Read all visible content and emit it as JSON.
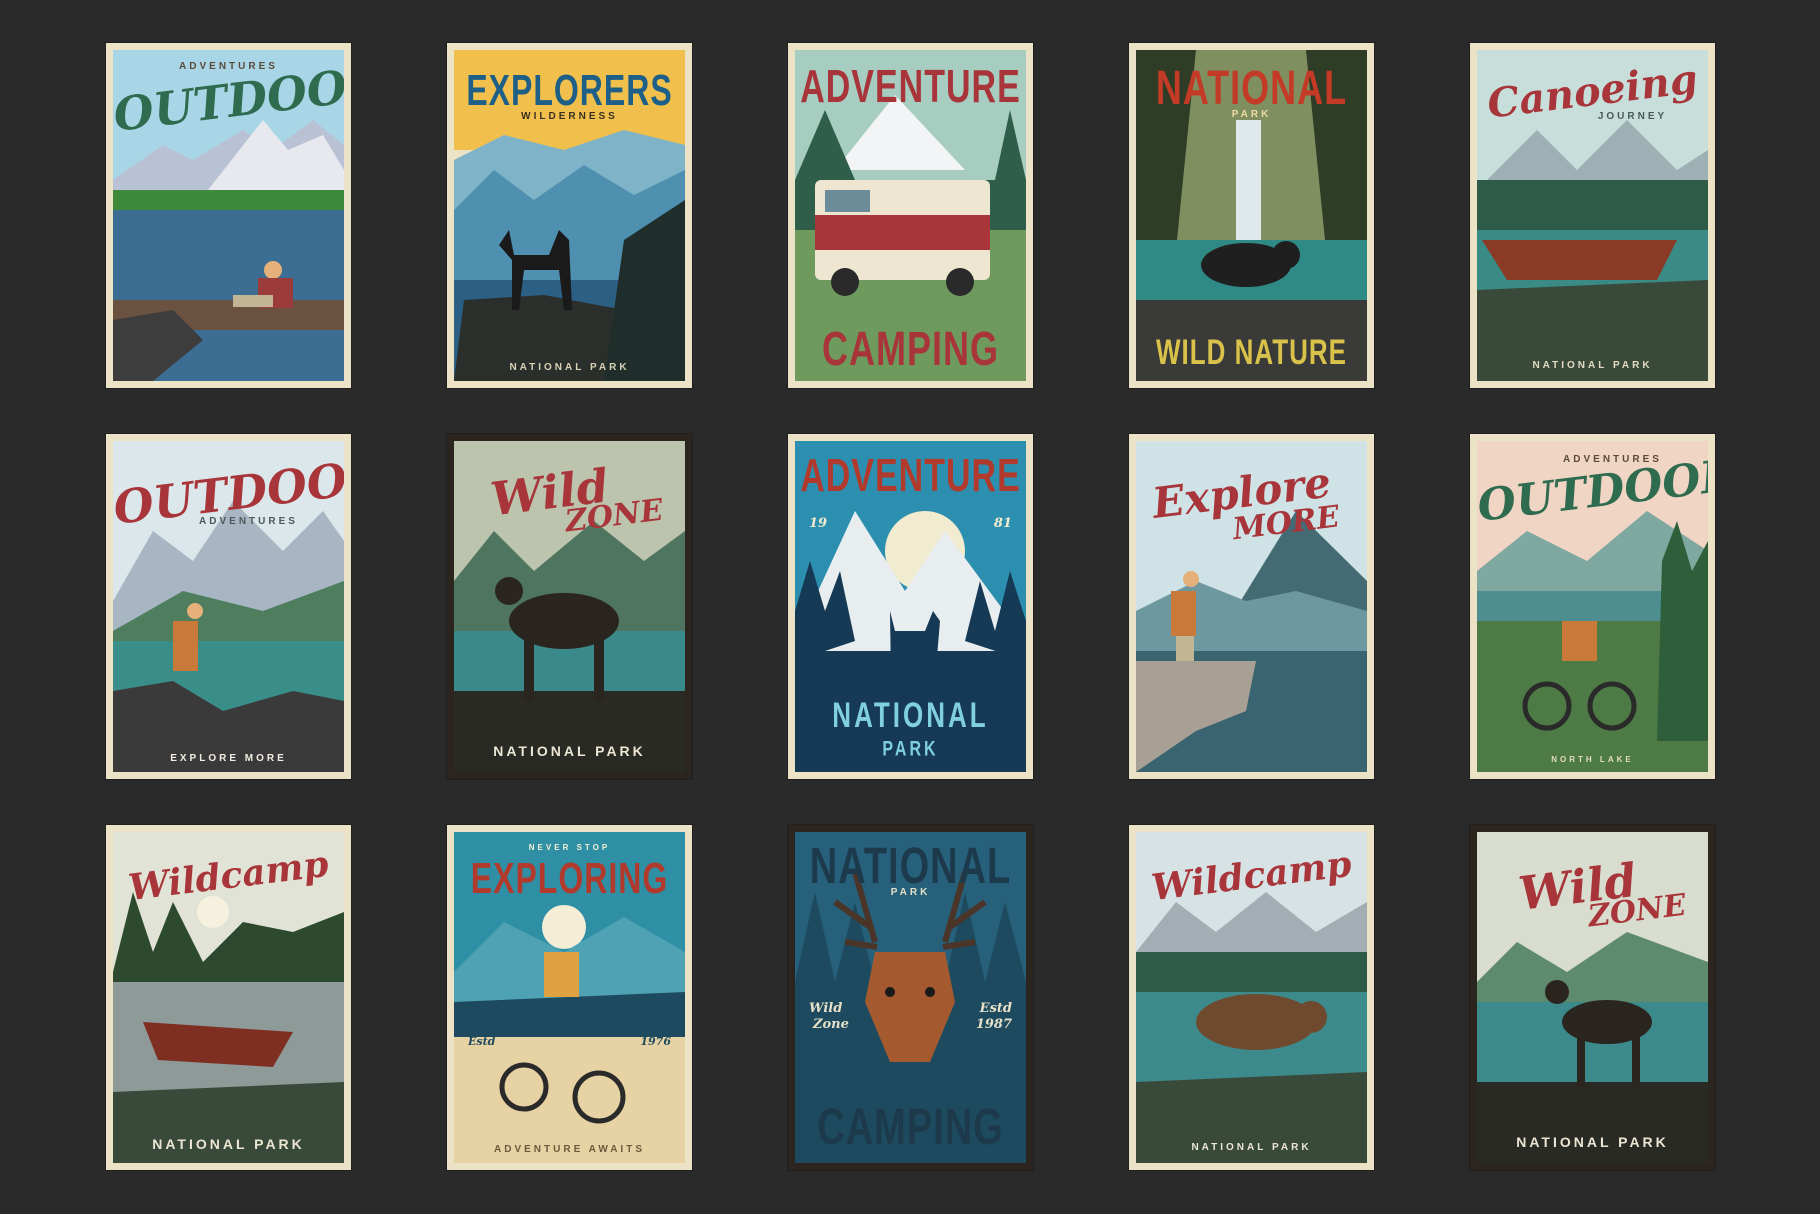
{
  "posters": [
    {
      "title": "OUTDOOR",
      "subtitle": "ADVENTURES"
    },
    {
      "title": "EXPLORERS",
      "subtitle": "WILDERNESS",
      "footer": "NATIONAL PARK"
    },
    {
      "title": "ADVENTURE",
      "footer": "CAMPING"
    },
    {
      "title": "NATIONAL",
      "subtitle": "PARK",
      "footer": "WILD NATURE"
    },
    {
      "title": "Canoeing",
      "subtitle": "JOURNEY",
      "footer": "NATIONAL PARK"
    },
    {
      "title": "OUTDOOR",
      "subtitle": "ADVENTURES",
      "footer": "EXPLORE MORE"
    },
    {
      "title_line1": "Wild",
      "title_line2": "ZONE",
      "footer": "NATIONAL PARK"
    },
    {
      "title": "ADVENTURE",
      "year_left": "19",
      "year_right": "81",
      "footer_line1": "NATIONAL",
      "footer_line2": "PARK"
    },
    {
      "title_line1": "Explore",
      "title_line2": "MORE"
    },
    {
      "title": "OUTDOOR",
      "subtitle": "ADVENTURES",
      "footer": "NORTH LAKE"
    },
    {
      "title": "Wildcamp",
      "footer": "NATIONAL PARK"
    },
    {
      "title": "EXPLORING",
      "subtitle": "NEVER STOP",
      "badge_left": "Estd",
      "badge_right": "1976",
      "footer": "ADVENTURE AWAITS"
    },
    {
      "title": "NATIONAL",
      "subtitle": "PARK",
      "badge_left_line1": "Wild",
      "badge_left_line2": "Zone",
      "badge_right_line1": "Estd",
      "badge_right_line2": "1987",
      "footer": "CAMPING"
    },
    {
      "title": "Wildcamp",
      "footer": "NATIONAL PARK"
    },
    {
      "title_line1": "Wild",
      "title_line2": "ZONE",
      "footer": "NATIONAL PARK"
    }
  ],
  "colors": {
    "background": "#2a2a2a",
    "frame": "#ece2c6",
    "red": "#b23a2c",
    "green": "#2f6b4f",
    "teal": "#2f7f89",
    "navy": "#163a55",
    "cream": "#f3ead0"
  }
}
